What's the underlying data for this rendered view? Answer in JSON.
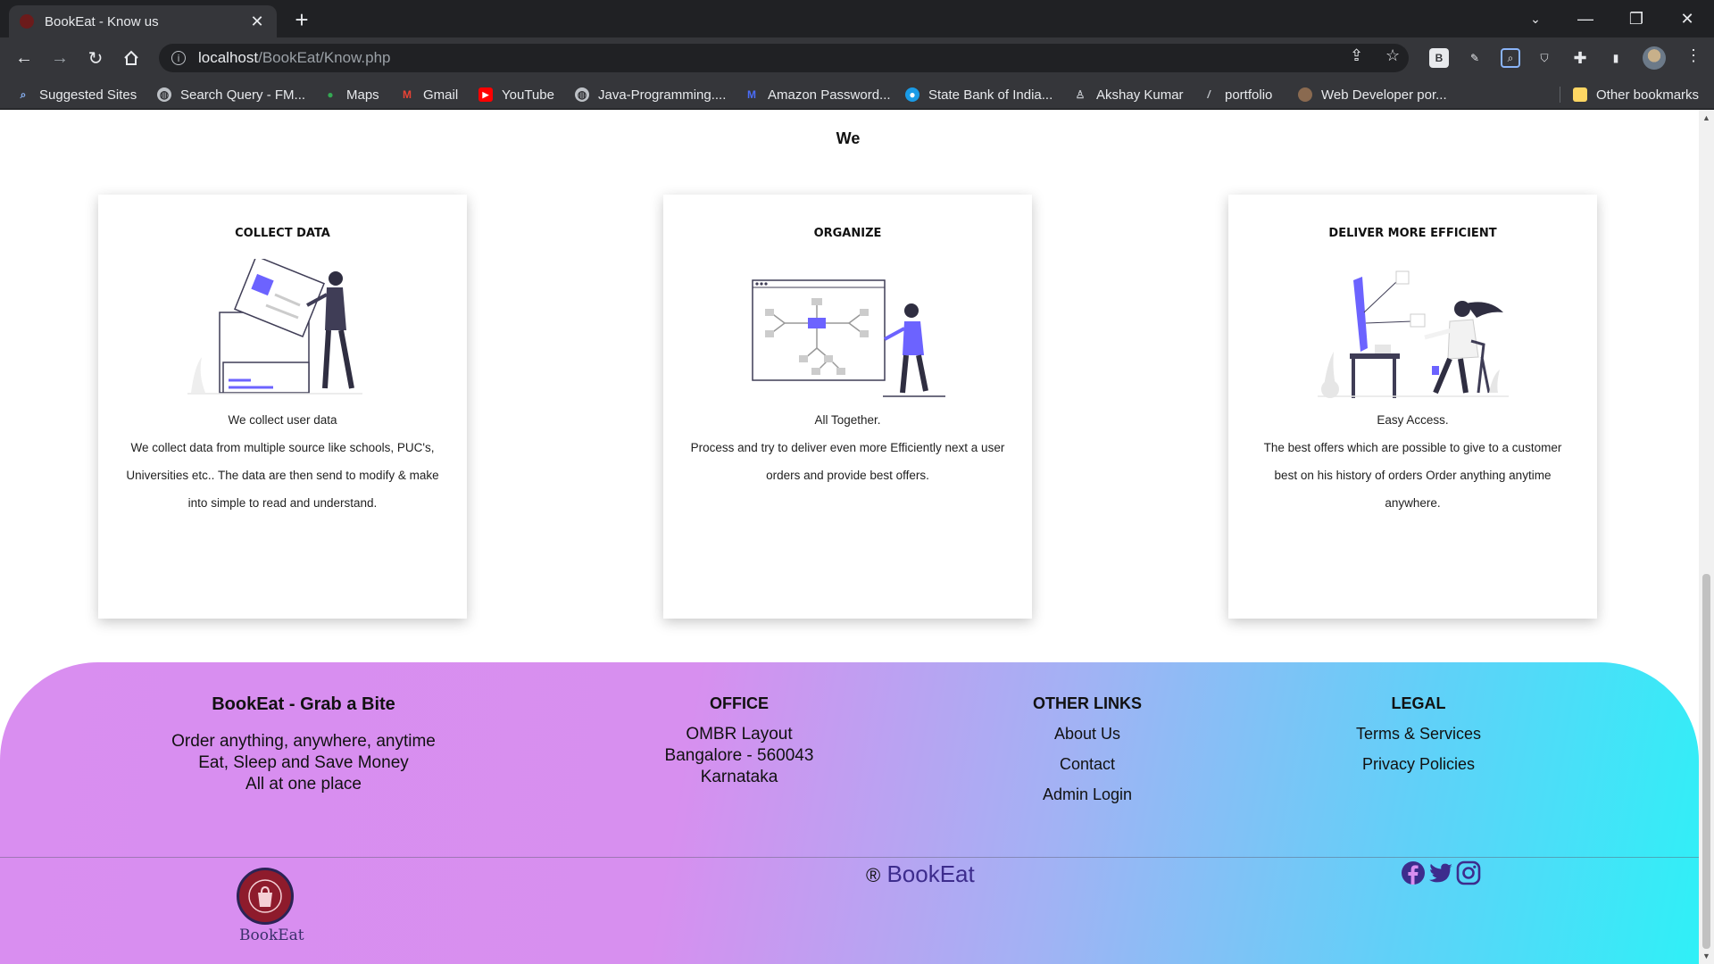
{
  "browser": {
    "tab_title": "BookEat - Know us",
    "url_host": "localhost",
    "url_path": "/BookEat/Know.php",
    "bookmarks": [
      {
        "label": "Suggested Sites",
        "icon": "search-icon"
      },
      {
        "label": "Search Query - FM...",
        "icon": "globe-icon"
      },
      {
        "label": "Maps",
        "icon": "maps-pin-icon"
      },
      {
        "label": "Gmail",
        "icon": "gmail-icon"
      },
      {
        "label": "YouTube",
        "icon": "youtube-icon"
      },
      {
        "label": "Java-Programming....",
        "icon": "globe-icon"
      },
      {
        "label": "Amazon Password...",
        "icon": "m-icon"
      },
      {
        "label": "State Bank of India...",
        "icon": "sbi-icon"
      },
      {
        "label": "Akshay Kumar",
        "icon": "person-icon"
      },
      {
        "label": "portfolio",
        "icon": "code-icon"
      },
      {
        "label": "Web Developer por...",
        "icon": "avatar-icon"
      }
    ],
    "other_bookmarks": "Other bookmarks"
  },
  "page": {
    "section_title": "We",
    "cards": [
      {
        "title": "COLLECT DATA",
        "illustration": "person-filing-document-illustration",
        "lines": [
          "We collect user data",
          "We collect data from multiple source like schools, PUC's,",
          "Universities etc.. The data are then send to modify & make",
          "into simple to read and understand."
        ]
      },
      {
        "title": "ORGANIZE",
        "illustration": "person-with-flowchart-illustration",
        "lines": [
          "All Together.",
          "Process and try to deliver even more Efficiently next a user",
          "orders and provide best offers."
        ]
      },
      {
        "title": "DELIVER MORE EFFICIENT",
        "illustration": "woman-at-computer-illustration",
        "lines": [
          "Easy Access.",
          "The best offers which are possible to give to a customer",
          "best on his history of orders Order anything anytime",
          "anywhere."
        ]
      }
    ]
  },
  "footer": {
    "brand_heading": "BookEat - Grab a Bite",
    "brand_lines": [
      "Order anything, anywhere, anytime",
      "Eat, Sleep and Save Money",
      "All at one place"
    ],
    "office_heading": "OFFICE",
    "office_lines": [
      "OMBR Layout",
      "Bangalore - 560043",
      "Karnataka"
    ],
    "links_heading": "OTHER LINKS",
    "links": [
      "About Us",
      "Contact",
      "Admin Login"
    ],
    "legal_heading": "LEGAL",
    "legal_links": [
      "Terms & Services",
      "Privacy Policies"
    ],
    "copyright_symbol": "®",
    "copyright_brand": "BookEat",
    "logo_text": "BookEat",
    "social_icons": [
      "facebook-icon",
      "twitter-icon",
      "instagram-icon"
    ],
    "brand_color": "#3d2c8d",
    "gradient": [
      "#d98ef0",
      "#a2b2f4",
      "#2ff0f7"
    ]
  }
}
